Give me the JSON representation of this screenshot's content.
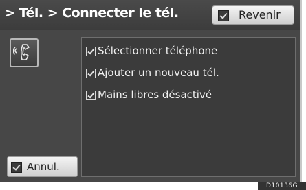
{
  "header": {
    "title": "> Tél. > Connecter le tél.",
    "back_label": "Revenir"
  },
  "side": {
    "icon": "voice-phone-icon",
    "cancel_label": "Annul."
  },
  "menu": {
    "items": [
      {
        "label": "Sélectionner téléphone",
        "icon": "checkbox-icon"
      },
      {
        "label": "Ajouter un nouveau tél.",
        "icon": "checkbox-icon"
      },
      {
        "label": "Mains libres désactivé",
        "icon": "checkbox-icon"
      }
    ]
  },
  "figure_code": "D10136G",
  "colors": {
    "screen_bg": "#474747",
    "panel_bg": "#3b3b3b",
    "button_bg": "#e6e6e6",
    "text": "#ffffff"
  }
}
